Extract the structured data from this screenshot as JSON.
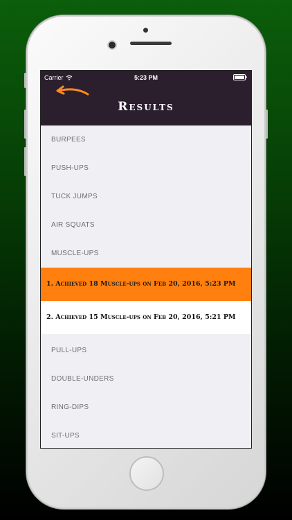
{
  "status_bar": {
    "carrier": "Carrier",
    "time": "5:23 PM",
    "wifi_icon": "wifi-icon",
    "battery_icon": "battery-icon"
  },
  "nav": {
    "title": "Results",
    "back_icon": "back-arrow-icon"
  },
  "exercises": {
    "burpees": "BURPEES",
    "pushups": "PUSH-UPS",
    "tuck_jumps": "TUCK JUMPS",
    "air_squats": "AIR SQUATS",
    "muscle_ups": "MUSCLE-UPS",
    "pull_ups": "PULL-UPS",
    "double_unders": "DOUBLE-UNDERS",
    "ring_dips": "RING-DIPS",
    "sit_ups": "SIT-UPS"
  },
  "results": [
    {
      "text": "1. Achieved 18 Muscle-ups on Feb 20, 2016, 5:23 PM"
    },
    {
      "text": "2. Achieved 15 Muscle-ups on Feb 20, 2016, 5:21 PM"
    }
  ],
  "colors": {
    "nav_background": "#2b1f2e",
    "highlight": "#ff7f0f",
    "back_arrow": "#ff8a1f",
    "list_background": "#efeff4",
    "page_background_top": "#0b5e0b"
  }
}
